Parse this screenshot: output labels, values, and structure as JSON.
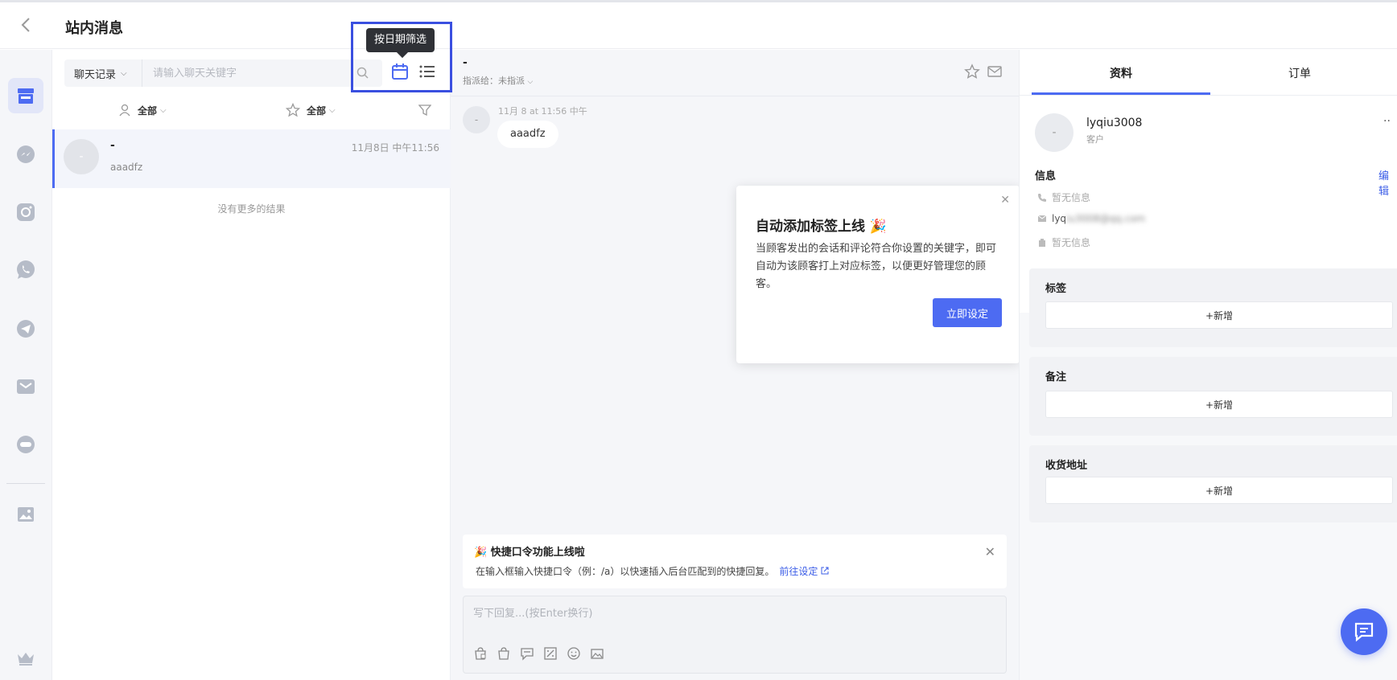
{
  "header": {
    "title": "站内消息"
  },
  "list": {
    "search_type": "聊天记录",
    "search_placeholder": "请输入聊天关键字",
    "tooltip": "按日期筛选",
    "filter_agent": "全部",
    "filter_star": "全部",
    "conversation": {
      "avatar": "-",
      "name": "-",
      "time": "11月8日 中午11:56",
      "preview": "aaadfz"
    },
    "no_more": "没有更多的结果"
  },
  "chat": {
    "title": "-",
    "assign": "指派给：未指派",
    "msg_avatar": "-",
    "msg_time": "11月 8 at 11:56 中午",
    "msg_text": "aaadfz",
    "popup": {
      "title": "自动添加标签上线 🎉",
      "body": "当顾客发出的会话和评论符合你设置的关键字，即可自动为该顾客打上对应标签，以便更好管理您的顾客。",
      "button": "立即设定"
    },
    "notice": {
      "title": "🎉 快捷口令功能上线啦",
      "desc": "在输入框输入快捷口令（例：/a）以快速插入后台匹配到的快捷回复。",
      "link": "前往设定"
    },
    "composer_placeholder": "写下回复...(按Enter换行)"
  },
  "profile": {
    "tab_info": "资料",
    "tab_orders": "订单",
    "avatar": "-",
    "name": "lyqiu3008",
    "role": "客户",
    "info_label": "信息",
    "edit": "编辑",
    "phone": "暂无信息",
    "email_prefix": "lyq",
    "email_masked": "iu3008@qq.com",
    "address": "暂无信息",
    "tags_label": "标签",
    "notes_label": "备注",
    "shipping_label": "收货地址",
    "add_label": "+新增"
  },
  "colors": {
    "accent": "#4d6bf2",
    "highlight": "#3a4fe0"
  }
}
